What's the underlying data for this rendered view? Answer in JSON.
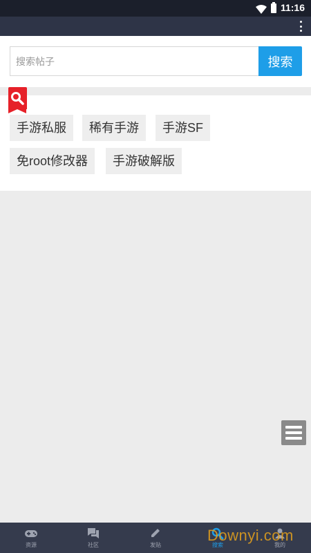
{
  "status_bar": {
    "time": "11:16",
    "wifi_icon": "wifi-icon",
    "battery_icon": "battery-icon"
  },
  "app_bar": {
    "overflow_icon": "more-vertical-icon"
  },
  "search": {
    "placeholder": "搜索帖子",
    "value": "",
    "button_label": "搜索"
  },
  "hot_tags": {
    "badge_icon": "search-icon",
    "items": [
      {
        "label": "手游私服"
      },
      {
        "label": "稀有手游"
      },
      {
        "label": "手游SF"
      },
      {
        "label": "免root修改器"
      },
      {
        "label": "手游破解版"
      }
    ]
  },
  "floating_menu": {
    "icon": "hamburger-menu-icon"
  },
  "bottom_nav": {
    "active_index": 3,
    "tabs": [
      {
        "label": "资源",
        "icon": "gamepad-icon"
      },
      {
        "label": "社区",
        "icon": "chat-bubbles-icon"
      },
      {
        "label": "发贴",
        "icon": "pencil-icon"
      },
      {
        "label": "搜索",
        "icon": "search-icon"
      },
      {
        "label": "我的",
        "icon": "person-icon"
      }
    ]
  },
  "watermark": {
    "text": "Downyi.com"
  },
  "colors": {
    "accent": "#1e9ee8",
    "status_bar": "#1b1f2b",
    "app_bar": "#2e3447",
    "tab_bar": "#353b4d",
    "badge": "#e62129",
    "background": "#ececec"
  }
}
